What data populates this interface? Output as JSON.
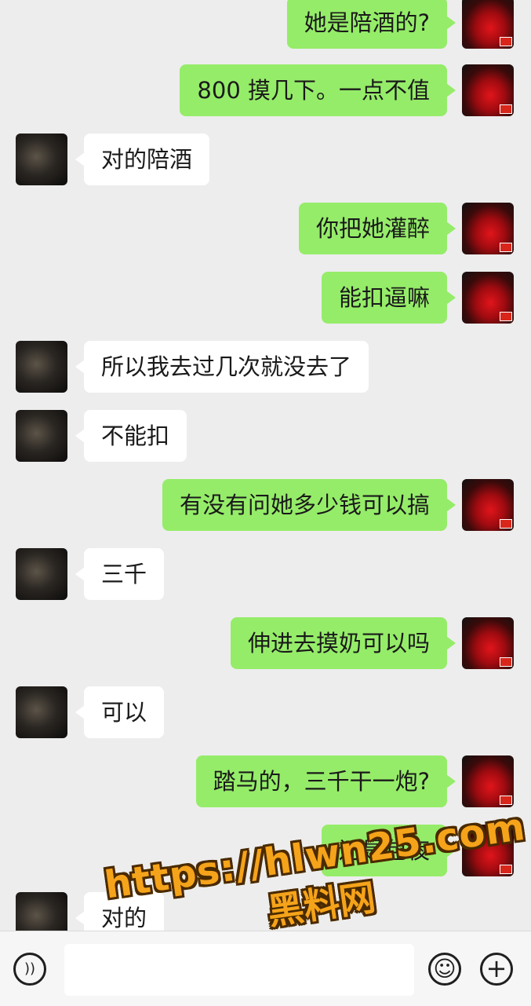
{
  "messages": [
    {
      "side": "self",
      "text": "她是陪酒的?"
    },
    {
      "side": "self",
      "text": "800 摸几下。一点不值"
    },
    {
      "side": "peer",
      "text": "对的陪酒"
    },
    {
      "side": "self",
      "text": "你把她灌醉"
    },
    {
      "side": "self",
      "text": "能扣逼嘛"
    },
    {
      "side": "peer",
      "text": "所以我去过几次就没去了"
    },
    {
      "side": "peer",
      "text": "不能扣"
    },
    {
      "side": "self",
      "text": "有没有问她多少钱可以搞"
    },
    {
      "side": "peer",
      "text": "三千"
    },
    {
      "side": "self",
      "text": "伸进去摸奶可以吗"
    },
    {
      "side": "peer",
      "text": "可以"
    },
    {
      "side": "self",
      "text": "踏马的，三千干一炮?"
    },
    {
      "side": "self",
      "text": "还是包夜"
    },
    {
      "side": "peer",
      "text": "对的"
    }
  ],
  "input_bar": {
    "voice_icon": "voice-icon",
    "emoji_icon": "emoji-icon",
    "plus_icon": "plus-icon",
    "voice_glyph": "))",
    "emoji_glyph": "☺",
    "plus_glyph": "+"
  },
  "watermark": {
    "url": "https://hlwn25.com",
    "name": "黑料网"
  },
  "colors": {
    "self_bubble": "#95ec69",
    "peer_bubble": "#ffffff",
    "background": "#ededed",
    "watermark": "#f5a31a"
  }
}
